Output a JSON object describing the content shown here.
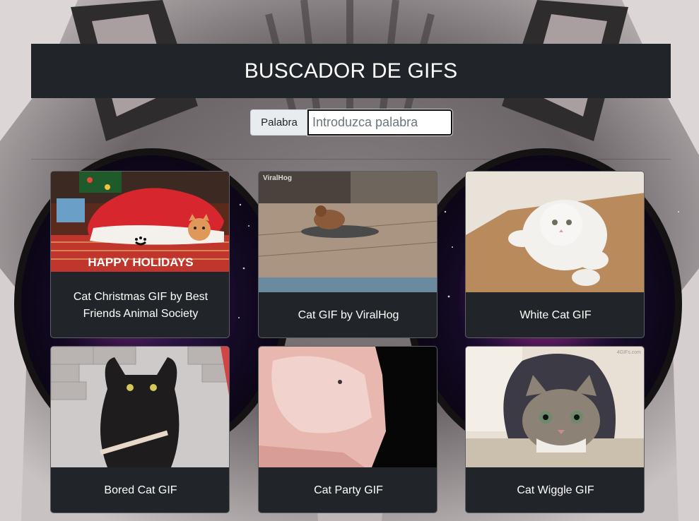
{
  "header": {
    "title": "BUSCADOR DE GIFS"
  },
  "search": {
    "addon_label": "Palabra",
    "placeholder": "Introduzca palabra",
    "value": ""
  },
  "gifs": [
    {
      "title": "Cat Christmas GIF by Best Friends Animal Society",
      "overlay_text": "HAPPY HOLIDAYS"
    },
    {
      "title": "Cat GIF by ViralHog",
      "overlay_text": "ViralHog"
    },
    {
      "title": "White Cat GIF"
    },
    {
      "title": "Bored Cat GIF"
    },
    {
      "title": "Cat Party GIF"
    },
    {
      "title": "Cat Wiggle GIF",
      "overlay_text": "4GIFs.com"
    }
  ],
  "colors": {
    "header_bg": "#212529",
    "card_bg": "#212529",
    "text": "#ffffff"
  }
}
